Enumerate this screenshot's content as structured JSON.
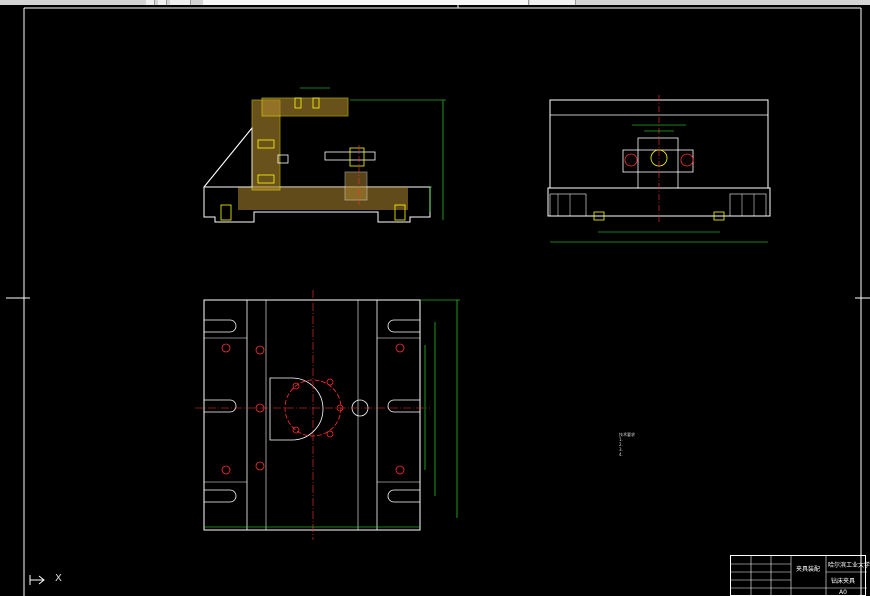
{
  "window": {
    "toolbar_buttons": [
      "",
      "",
      ""
    ]
  },
  "drawing": {
    "background": "#000000",
    "colors": {
      "outline": "#ffffff",
      "centerline": "#ff3030",
      "dimension": "#33ff33",
      "hatch": "#c8a040",
      "part_yellow": "#ffff00",
      "frame_blue": "#4aa0ff"
    },
    "views": [
      "front-view-section",
      "side-view",
      "top-view"
    ],
    "ucs_label": "X",
    "tech_notes": {
      "title": "技术要求",
      "lines": [
        "1.",
        "2.",
        "3.",
        "4."
      ]
    },
    "title_block": {
      "name": "夹具装配",
      "school": "哈尔滨工业大学",
      "drawing_no": "钻床夹具",
      "scale": "A0"
    }
  }
}
